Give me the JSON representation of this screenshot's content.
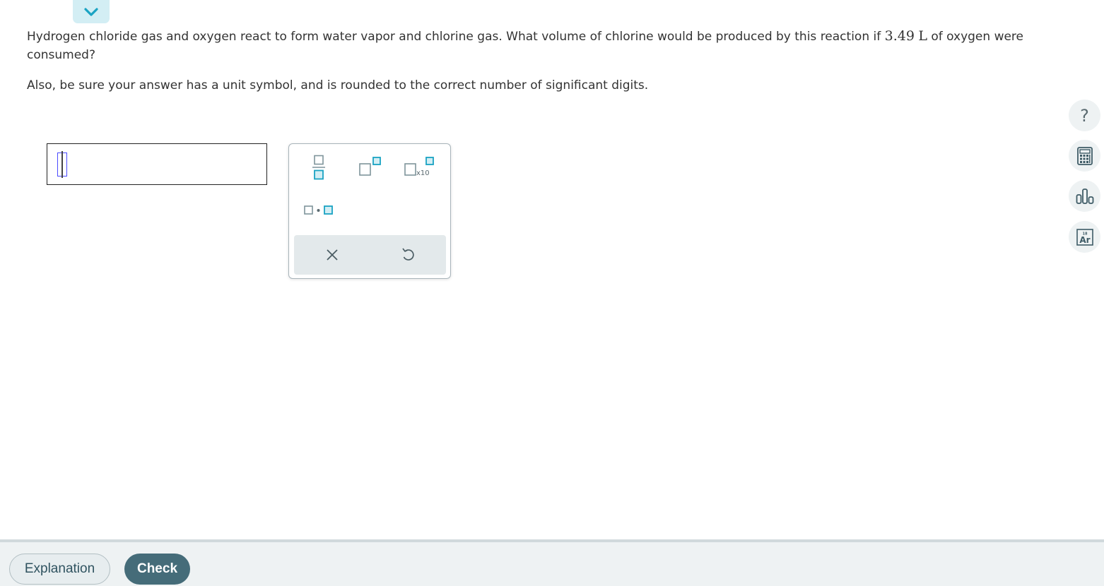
{
  "question": {
    "text_before": "Hydrogen chloride gas and oxygen react to form water vapor and chlorine gas. What volume of chlorine would be produced by this reaction if ",
    "quantity_value": "3.49",
    "quantity_unit": "L",
    "text_after": " of oxygen were consumed?",
    "instruction": "Also, be sure your answer has a unit symbol, and is rounded to the correct number of significant digits."
  },
  "answer": {
    "value": ""
  },
  "palette": {
    "buttons": [
      {
        "name": "fraction",
        "icon": "fraction-icon"
      },
      {
        "name": "superscript",
        "icon": "superscript-icon"
      },
      {
        "name": "scientific-notation",
        "icon": "x10-icon",
        "label": "x10"
      },
      {
        "name": "multiply-dot",
        "icon": "dot-product-icon"
      }
    ],
    "actions": [
      {
        "name": "clear",
        "icon": "close-icon"
      },
      {
        "name": "undo",
        "icon": "undo-icon"
      }
    ]
  },
  "sidebar": {
    "tools": [
      {
        "name": "help",
        "icon": "question-icon",
        "glyph": "?"
      },
      {
        "name": "calculator",
        "icon": "calculator-icon"
      },
      {
        "name": "data",
        "icon": "bar-chart-icon"
      },
      {
        "name": "periodic-table",
        "icon": "periodic-table-icon",
        "symbol": "Ar",
        "number": "18"
      }
    ]
  },
  "footer": {
    "explanation_label": "Explanation",
    "check_label": "Check"
  },
  "colors": {
    "accent": "#1aa3c3",
    "button_dark": "#456c79",
    "collapse_bg": "#d3eef4"
  }
}
